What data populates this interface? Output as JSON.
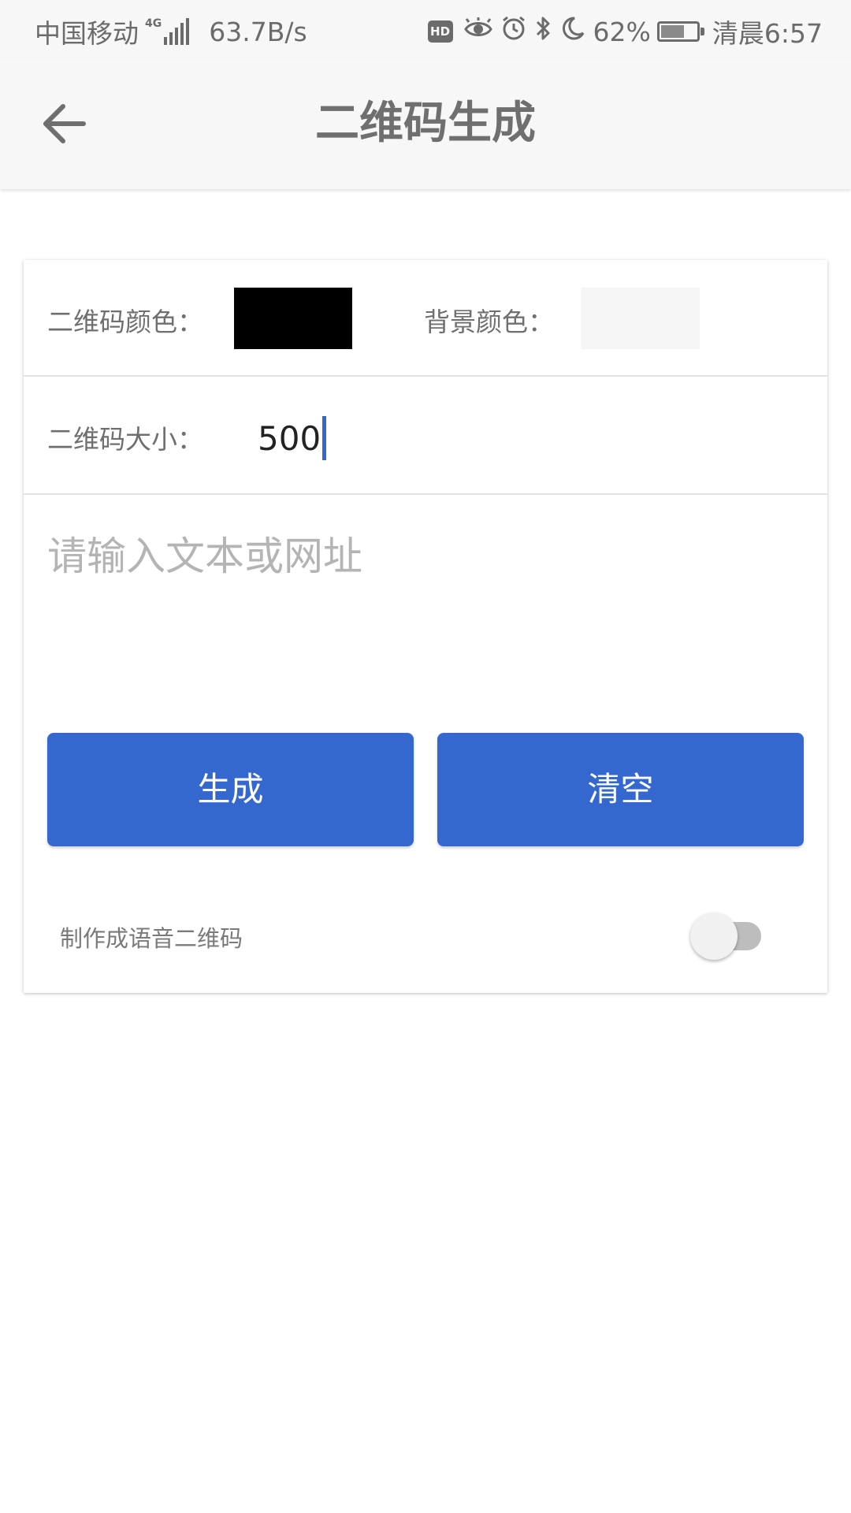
{
  "status_bar": {
    "carrier": "中国移动",
    "network_type": "4G",
    "speed": "63.7B/s",
    "hd_badge": "HD",
    "battery_percent": "62%",
    "time": "清晨6:57",
    "icons": [
      "signal-icon",
      "hd-icon",
      "eye-icon",
      "alarm-icon",
      "bluetooth-icon",
      "moon-icon",
      "battery-icon"
    ]
  },
  "toolbar": {
    "title": "二维码生成",
    "back_icon": "arrow-left-icon"
  },
  "form": {
    "qr_color_label": "二维码颜色：",
    "qr_color": "#000000",
    "bg_color_label": "背景颜色：",
    "bg_color": "#f5f5f5",
    "size_label": "二维码大小：",
    "size_value": "500",
    "text_placeholder": "请输入文本或网址",
    "generate_button": "生成",
    "clear_button": "清空",
    "voice_qr_label": "制作成语音二维码",
    "voice_qr_enabled": false
  },
  "colors": {
    "accent": "#3568cf",
    "toolbar_bg": "#f7f7f7"
  }
}
